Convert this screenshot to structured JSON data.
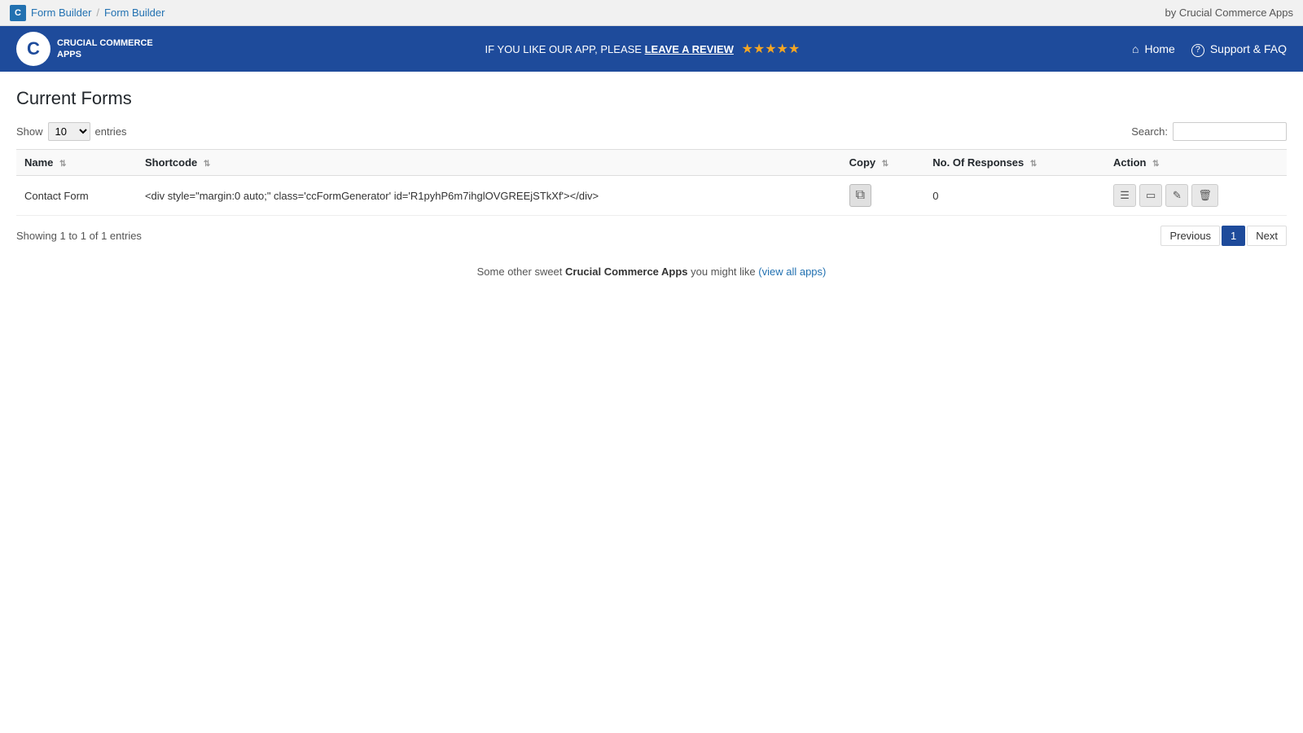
{
  "adminBar": {
    "iconLabel": "C",
    "breadcrumbs": [
      {
        "label": "Form Builder",
        "href": "#"
      },
      {
        "label": "Form Builder",
        "href": "#"
      }
    ],
    "separator": "/",
    "rightText": "by Crucial Commerce Apps"
  },
  "header": {
    "logoLineOne": "CRUCIAL COMMERCE",
    "logoLineTwo": "APPS",
    "promoText": "IF YOU LIKE OUR APP, PLEASE",
    "promoLink": "LEAVE A REVIEW",
    "stars": "★★★★★",
    "navItems": [
      {
        "icon": "home-icon",
        "label": "Home"
      },
      {
        "icon": "support-icon",
        "label": "Support & FAQ"
      }
    ]
  },
  "page": {
    "title": "Current Forms",
    "showLabel": "Show",
    "showValue": "10",
    "entriesLabel": "entries",
    "searchLabel": "Search:",
    "searchValue": ""
  },
  "table": {
    "columns": [
      {
        "key": "name",
        "label": "Name"
      },
      {
        "key": "shortcode",
        "label": "Shortcode"
      },
      {
        "key": "copy",
        "label": "Copy"
      },
      {
        "key": "responses",
        "label": "No. Of Responses"
      },
      {
        "key": "action",
        "label": "Action"
      }
    ],
    "rows": [
      {
        "name": "Contact Form",
        "shortcode": "<div style=\"margin:0 auto;\" class='ccFormGenerator' id='R1pyhP6m7ihglOVGREEjSTkXf'></div>",
        "copy_title": "Copy",
        "responses": "0"
      }
    ],
    "actionButtons": [
      {
        "icon": "list-icon",
        "title": "View Responses"
      },
      {
        "icon": "preview-icon",
        "title": "Preview"
      },
      {
        "icon": "edit-icon",
        "title": "Edit"
      },
      {
        "icon": "delete-icon",
        "title": "Delete"
      }
    ]
  },
  "pagination": {
    "infoText": "Showing 1 to 1 of 1 entries",
    "previousLabel": "Previous",
    "nextLabel": "Next",
    "currentPage": "1"
  },
  "footerNote": {
    "prefix": "Some other sweet",
    "brand": "Crucial Commerce Apps",
    "suffix": "you might like",
    "linkLabel": "(view all apps)",
    "linkHref": "#"
  }
}
